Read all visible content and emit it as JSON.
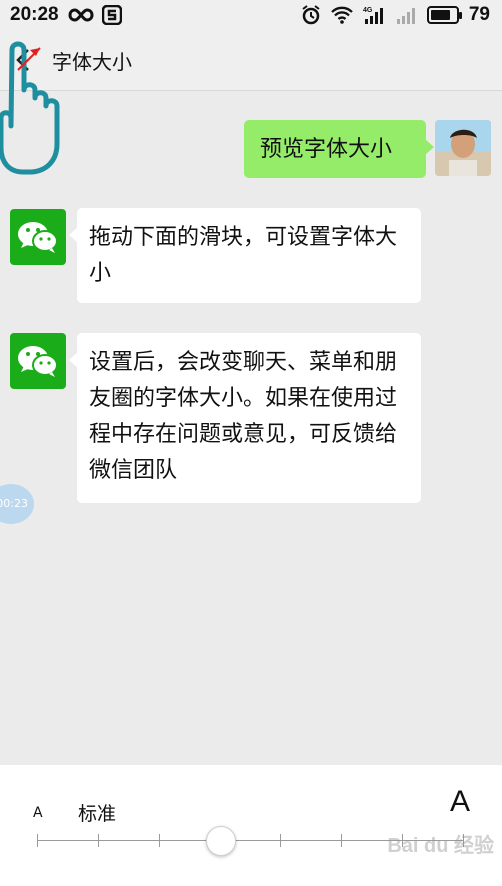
{
  "status_bar": {
    "time": "20:28",
    "battery_level": "79",
    "battery_fraction": 0.79,
    "icons": [
      "infinity-icon",
      "s-app-icon",
      "alarm-icon",
      "wifi-icon",
      "4g-signal-icon",
      "signal-icon"
    ]
  },
  "header": {
    "back_icon": "chevron-left-icon",
    "title": "字体大小"
  },
  "messages": [
    {
      "side": "right",
      "sender": "user-avatar",
      "text": "预览字体大小"
    },
    {
      "side": "left",
      "sender": "wechat-avatar",
      "text": "拖动下面的滑块，可设置字体大小"
    },
    {
      "side": "left",
      "sender": "wechat-avatar",
      "text": "设置后，会改变聊天、菜单和朋友圈的字体大小。如果在使用过程中存在问题或意见，可反馈给微信团队"
    }
  ],
  "floating_timer": "00:23",
  "font_size_panel": {
    "small_label": "A",
    "current_label": "标准",
    "large_label": "A",
    "slider_steps": 8,
    "slider_value_index": 3
  },
  "watermark": "Bai du 经验",
  "colors": {
    "wechat_green": "#1aad19",
    "sent_bubble": "#95ec69",
    "received_bubble": "#ffffff",
    "background": "#ebebeb"
  }
}
